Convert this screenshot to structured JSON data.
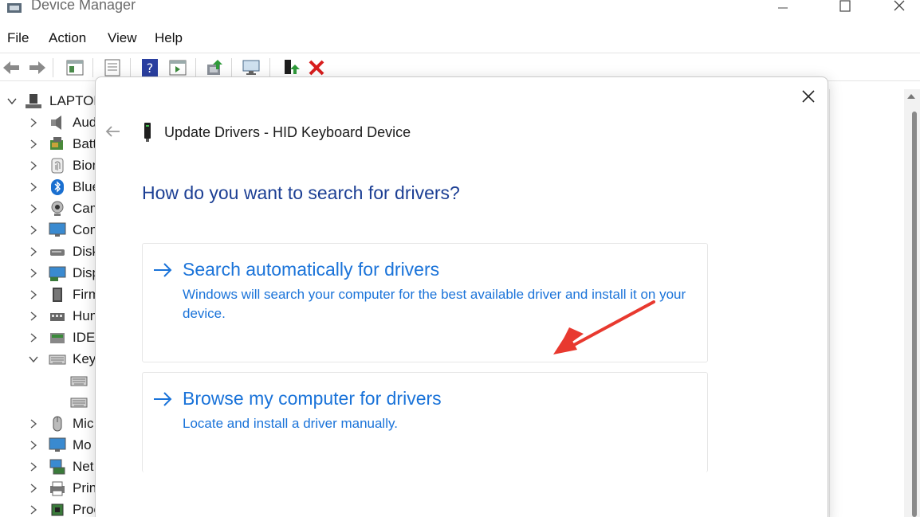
{
  "window": {
    "title": "Device Manager"
  },
  "menu": [
    "File",
    "Action",
    "View",
    "Help"
  ],
  "tree": {
    "root_label": "LAPTOP",
    "items": [
      {
        "label": "Aud",
        "icon": "speaker-icon"
      },
      {
        "label": "Batt",
        "icon": "battery-icon"
      },
      {
        "label": "Bion",
        "icon": "fingerprint-icon"
      },
      {
        "label": "Blue",
        "icon": "bluetooth-icon"
      },
      {
        "label": "Cam",
        "icon": "camera-icon"
      },
      {
        "label": "Con",
        "icon": "monitor-icon"
      },
      {
        "label": "Disk",
        "icon": "disk-icon"
      },
      {
        "label": "Disp",
        "icon": "display-adapter-icon"
      },
      {
        "label": "Firm",
        "icon": "firmware-icon"
      },
      {
        "label": "Hun",
        "icon": "hid-icon"
      },
      {
        "label": "IDE",
        "icon": "ide-icon"
      },
      {
        "label": "Key",
        "icon": "keyboard-icon"
      },
      {
        "label": "",
        "icon": "keyboard-icon"
      },
      {
        "label": "",
        "icon": "keyboard-icon"
      },
      {
        "label": "Mic",
        "icon": "mouse-icon"
      },
      {
        "label": "Mo",
        "icon": "monitor-icon"
      },
      {
        "label": "Net",
        "icon": "network-icon"
      },
      {
        "label": "Prin",
        "icon": "printer-icon"
      },
      {
        "label": "Proc",
        "icon": "processor-icon"
      }
    ]
  },
  "dialog": {
    "title": "Update Drivers - HID Keyboard Device",
    "heading": "How do you want to search for drivers?",
    "options": [
      {
        "title": "Search automatically for drivers",
        "description": "Windows will search your computer for the best available driver and install it on your device."
      },
      {
        "title": "Browse my computer for drivers",
        "description": "Locate and install a driver manually."
      }
    ]
  },
  "colors": {
    "link_blue": "#1a73d9",
    "heading_blue": "#1c3f94",
    "annotation_red": "#e8392f"
  }
}
